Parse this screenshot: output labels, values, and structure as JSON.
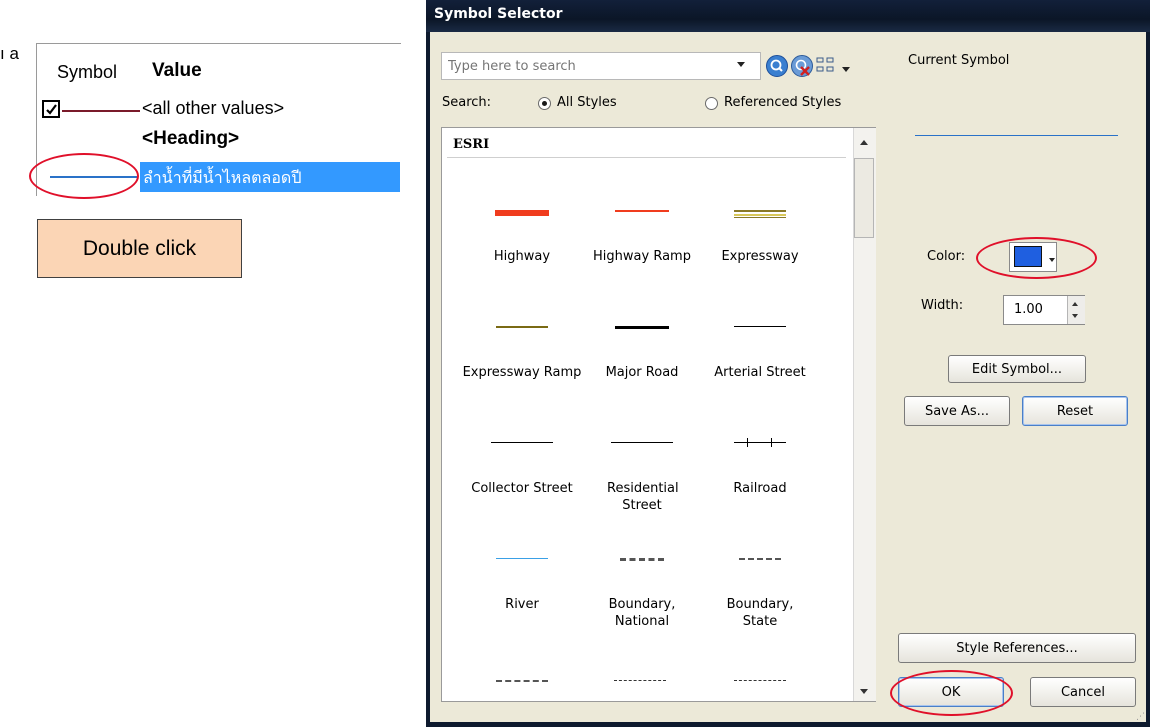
{
  "left_panel": {
    "fragment_text": "ı a",
    "col_symbol": "Symbol",
    "col_value": "Value",
    "row_other": "<all other values>",
    "row_heading": "<Heading>",
    "row_selected": "ลำน้ำที่มีน้ำไหลตลอดปี",
    "callout": "Double click"
  },
  "dialog": {
    "title": "Symbol Selector",
    "search": {
      "placeholder": "Type here to search",
      "label": "Search:",
      "opt_all": "All Styles",
      "opt_ref": "Referenced Styles",
      "selected": "All Styles"
    },
    "style_group": "ESRI",
    "symbols": [
      {
        "label": "Highway",
        "color": "#f03c1e"
      },
      {
        "label": "Highway Ramp",
        "color": "#f03c1e"
      },
      {
        "label": "Expressway",
        "color": "#8a7a28"
      },
      {
        "label": "Expressway Ramp",
        "color": "#7a6a14"
      },
      {
        "label": "Major Road",
        "color": "#000000"
      },
      {
        "label": "Arterial Street",
        "color": "#000000"
      },
      {
        "label": "Collector Street",
        "color": "#000000"
      },
      {
        "label": "Residential Street",
        "color": "#000000"
      },
      {
        "label": "Railroad",
        "color": "#000000"
      },
      {
        "label": "River",
        "color": "#3aa0e6"
      },
      {
        "label": "Boundary, National",
        "color": "#555555"
      },
      {
        "label": "Boundary, State",
        "color": "#555555"
      }
    ],
    "current_symbol_label": "Current Symbol",
    "color_label": "Color:",
    "color_value": "#1f5fe0",
    "width_label": "Width:",
    "width_value": "1.00",
    "edit_symbol": "Edit Symbol...",
    "save_as": "Save As...",
    "reset": "Reset",
    "style_refs": "Style References...",
    "ok": "OK",
    "cancel": "Cancel"
  }
}
